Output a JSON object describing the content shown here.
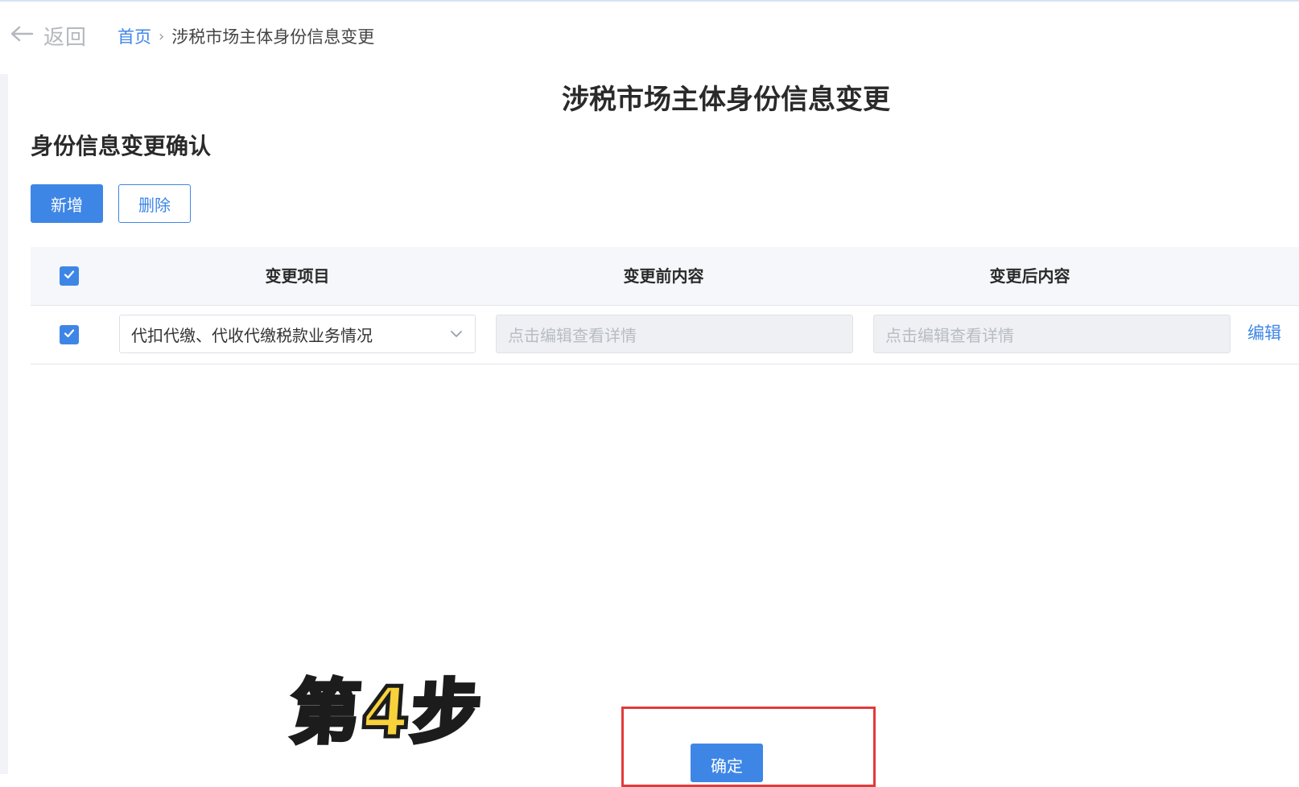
{
  "nav": {
    "back_label": "返回",
    "breadcrumb_home": "首页",
    "breadcrumb_separator": "›",
    "breadcrumb_current": "涉税市场主体身份信息变更"
  },
  "page": {
    "title": "涉税市场主体身份信息变更",
    "section_title": "身份信息变更确认"
  },
  "toolbar": {
    "add_label": "新增",
    "delete_label": "删除"
  },
  "table": {
    "columns": [
      "变更项目",
      "变更前内容",
      "变更后内容"
    ],
    "rows": [
      {
        "checked": true,
        "item": "代扣代缴、代收代缴税款业务情况",
        "before_placeholder": "点击编辑查看详情",
        "after_placeholder": "点击编辑查看详情",
        "action_label": "编辑"
      }
    ],
    "header_checked": true
  },
  "overlay": {
    "step_label": "第4步",
    "confirm_label": "确定"
  },
  "colors": {
    "primary": "#3e86e6",
    "highlight": "#e23b3b",
    "step_badge": "#f7d23a"
  }
}
